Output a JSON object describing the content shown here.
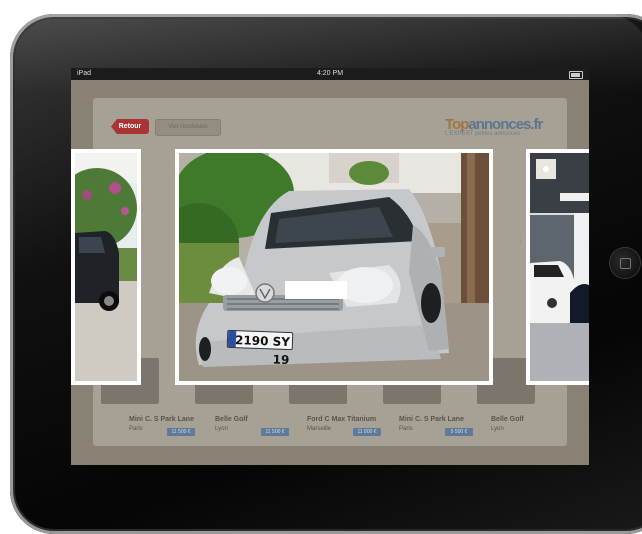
{
  "device": {
    "name": "iPad"
  },
  "statusbar": {
    "carrier": "iPad",
    "time": "4:20 PM"
  },
  "toolbar": {
    "back_label": "Retour",
    "exclusion_label": "Voir l'exclusion"
  },
  "brand": {
    "logo_part1": "Top",
    "logo_part2": "annonces.fr",
    "tagline": "L'EXPERT petites annonces"
  },
  "viewer": {
    "plate_text": "2190 SY 19",
    "main_photo_subject": "silver Volkswagen Golf",
    "colors": {
      "car_body": "#c6c9cc",
      "foliage": "#3f7a2a",
      "gravel": "#a89c8c",
      "trunk": "#6b4f38"
    }
  },
  "listings": [
    {
      "title": "Mini C. S Park Lane",
      "city": "Paris",
      "price": "11 500 €"
    },
    {
      "title": "Belle Golf",
      "city": "Lyon",
      "price": "11 500 €"
    },
    {
      "title": "Ford C Max Titanium",
      "city": "Marseille",
      "price": "11 800 €"
    },
    {
      "title": "Mini C. S Park Lane",
      "city": "Paris",
      "price": "9 500 €"
    },
    {
      "title": "Belle Golf",
      "city": "Lyon",
      "price": ""
    }
  ]
}
